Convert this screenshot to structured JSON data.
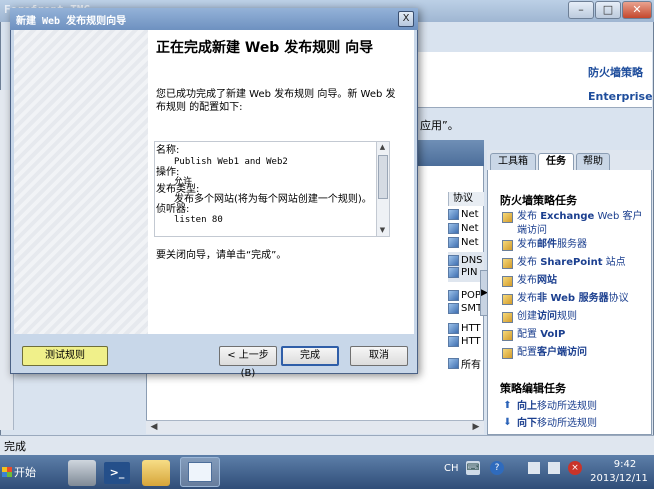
{
  "tmg": {
    "title": "Forefront TMG",
    "policy_title": "防火墙策略",
    "enterprise": "Enterprise",
    "app_note": "应用”。",
    "status": "完成",
    "protocol_header": "协议",
    "protocols": [
      "Net",
      "Net",
      "Net",
      "DNS",
      "PIN",
      "POP",
      "SMT",
      "HTT",
      "HTT",
      "所有"
    ]
  },
  "task_pane": {
    "tabs": [
      "工具箱",
      "任务",
      "帮助"
    ],
    "heading": "防火墙策略任务",
    "tasks": [
      {
        "prefix": "发布 ",
        "bold": "Exchange",
        "suffix": " Web 客户端访问"
      },
      {
        "prefix": "发布",
        "bold": "邮件",
        "suffix": "服务器"
      },
      {
        "prefix": "发布 ",
        "bold": "SharePoint",
        "suffix": " 站点"
      },
      {
        "prefix": "发布",
        "bold": "网站",
        "suffix": ""
      },
      {
        "prefix": "发布",
        "bold": "非 Web 服务器",
        "suffix": "协议"
      },
      {
        "prefix": "创建",
        "bold": "访问",
        "suffix": "规则"
      },
      {
        "prefix": "配置 ",
        "bold": "VoIP",
        "suffix": ""
      },
      {
        "prefix": "配置",
        "bold": "客户端访问",
        "suffix": ""
      }
    ],
    "edit_heading": "策略编辑任务",
    "edit_tasks": [
      {
        "bold": "向上",
        "suffix": "移动所选规则"
      },
      {
        "bold": "向下",
        "suffix": "移动所选规则"
      }
    ]
  },
  "wizard": {
    "title": "新建 Web 发布规则向导",
    "close": "X",
    "heading": "正在完成新建 Web 发布规则 向导",
    "intro": "您已成功完成了新建 Web 发布规则 向导。新 Web 发布规则 的配置如下:",
    "summary": [
      {
        "label": "名称:",
        "value": "Publish Web1 and Web2"
      },
      {
        "label": "操作:",
        "value": "允许"
      },
      {
        "label": "发布类型:",
        "value": "发布多个网站(将为每个网站创建一个规则)。"
      },
      {
        "label": "侦听器:",
        "value": "listen 80"
      }
    ],
    "close_note": "要关闭向导，请单击“完成”。",
    "buttons": {
      "test": "测试规则",
      "back": "< 上一步(B)",
      "finish": "完成",
      "cancel": "取消"
    }
  },
  "taskbar": {
    "start": "开始",
    "lang": "CH",
    "time": "9:42",
    "date": "2013/12/11"
  }
}
